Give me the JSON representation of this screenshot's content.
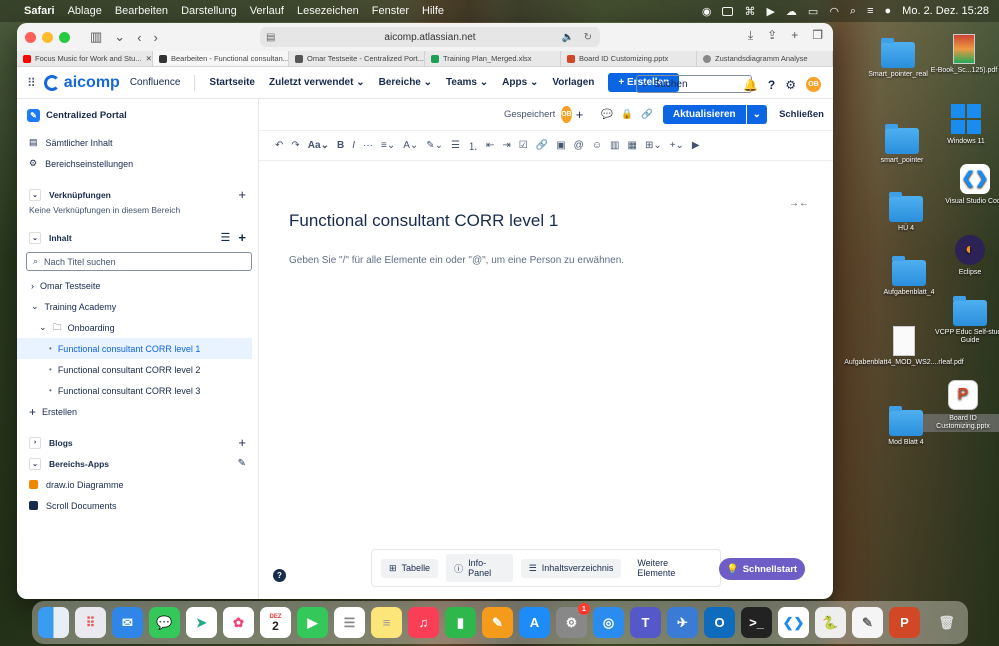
{
  "menubar": {
    "app": "Safari",
    "items": [
      "Ablage",
      "Bearbeiten",
      "Darstellung",
      "Verlauf",
      "Lesezeichen",
      "Fenster",
      "Hilfe"
    ],
    "datetime": "Mo. 2. Dez.  15:28"
  },
  "browser": {
    "url": "aicomp.atlassian.net",
    "tabs": [
      "Focus Music for Work and Stu...",
      "Bearbeiten - Functional consultan...",
      "Omar Testseite - Centralized Port...",
      "Training Plan_Merged.xlsx",
      "Board ID Customizing.pptx",
      "Zustandsdiagramm Analyse"
    ]
  },
  "header": {
    "logo": "aicomp",
    "product": "Confluence",
    "nav": [
      "Startseite",
      "Zuletzt verwendet",
      "Bereiche",
      "Teams",
      "Apps",
      "Vorlagen"
    ],
    "create": "+ Erstellen",
    "search_placeholder": "Suchen",
    "user_initials": "OB"
  },
  "sidebar": {
    "space": "Centralized Portal",
    "all_content": "Sämtlicher Inhalt",
    "space_settings": "Bereichseinstellungen",
    "shortcuts": "Verknüpfungen",
    "shortcuts_empty": "Keine Verknüpfungen in diesem Bereich",
    "content": "Inhalt",
    "filter_placeholder": "Nach Titel suchen",
    "tree": [
      "Omar Testseite",
      "Training Academy",
      "Onboarding",
      "Functional consultant CORR level 1",
      "Functional consultant CORR level 2",
      "Functional consultant CORR level 3"
    ],
    "create": "Erstellen",
    "blogs": "Blogs",
    "apps": "Bereichs-Apps",
    "app_items": [
      "draw.io Diagramme",
      "Scroll Documents"
    ]
  },
  "editor": {
    "saved": "Gespeichert",
    "update": "Aktualisieren",
    "close": "Schließen",
    "title": "Functional consultant CORR level 1",
    "placeholder": "Geben Sie \"/\" für alle Elemente ein oder \"@\", um eine Person zu erwähnen.",
    "text_style": "Aa",
    "bottom": {
      "table": "Tabelle",
      "info": "Info-Panel",
      "toc": "Inhaltsverzeichnis",
      "more": "Weitere Elemente",
      "quickstart": "Schnellstart"
    }
  },
  "desktop": {
    "items": [
      "Smart_pointer_real",
      "E-Book_Sc...125).pdf",
      "Windows 11",
      "smart_pointer",
      "Visual Studio Code",
      "HÜ 4",
      "Eclipse",
      "Aufgabenblatt_4",
      "VCPP Educ Self-study Guide",
      "Aufgabenblatt4_MOD_WS2....rleaf.pdf",
      "Board ID Customizing.pptx",
      "Mod Blatt 4"
    ]
  },
  "dock": {
    "calendar_month": "DEZ",
    "calendar_day": "2",
    "settings_badge": "1"
  },
  "colors": {
    "accent": "#0c66e4",
    "quickstart": "#6e5dc6",
    "avatar": "#f7a128"
  }
}
